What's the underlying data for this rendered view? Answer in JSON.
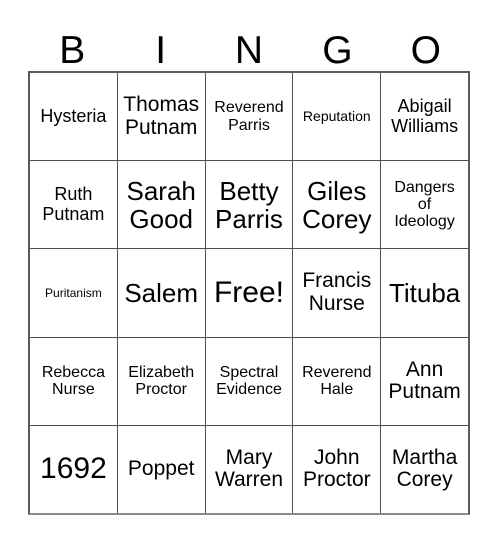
{
  "header": {
    "letters": [
      "B",
      "I",
      "N",
      "G",
      "O"
    ]
  },
  "grid": {
    "rows": [
      [
        {
          "text": "Hysteria",
          "size": "fs-lg"
        },
        {
          "text": "Thomas\nPutnam",
          "size": "fs-xl"
        },
        {
          "text": "Reverend\nParris",
          "size": "fs-md"
        },
        {
          "text": "Reputation",
          "size": "fs-sm"
        },
        {
          "text": "Abigail\nWilliams",
          "size": "fs-lg"
        }
      ],
      [
        {
          "text": "Ruth\nPutnam",
          "size": "fs-lg"
        },
        {
          "text": "Sarah\nGood",
          "size": "fs-xxl"
        },
        {
          "text": "Betty\nParris",
          "size": "fs-xxl"
        },
        {
          "text": "Giles\nCorey",
          "size": "fs-xxl"
        },
        {
          "text": "Dangers\nof\nIdeology",
          "size": "fs-md"
        }
      ],
      [
        {
          "text": "Puritanism",
          "size": "fs-xs"
        },
        {
          "text": "Salem",
          "size": "fs-xxl"
        },
        {
          "text": "Free!",
          "size": "fs-huge"
        },
        {
          "text": "Francis\nNurse",
          "size": "fs-xl"
        },
        {
          "text": "Tituba",
          "size": "fs-xxl"
        }
      ],
      [
        {
          "text": "Rebecca\nNurse",
          "size": "fs-md"
        },
        {
          "text": "Elizabeth\nProctor",
          "size": "fs-md"
        },
        {
          "text": "Spectral\nEvidence",
          "size": "fs-md"
        },
        {
          "text": "Reverend\nHale",
          "size": "fs-md"
        },
        {
          "text": "Ann\nPutnam",
          "size": "fs-xl"
        }
      ],
      [
        {
          "text": "1692",
          "size": "fs-huge"
        },
        {
          "text": "Poppet",
          "size": "fs-xl"
        },
        {
          "text": "Mary\nWarren",
          "size": "fs-xl"
        },
        {
          "text": "John\nProctor",
          "size": "fs-xl"
        },
        {
          "text": "Martha\nCorey",
          "size": "fs-xl"
        }
      ]
    ]
  },
  "colors": {
    "background": "#ffffff",
    "text": "#000000",
    "grid_line": "#4d4d4d",
    "grid_border": "#5a5a5a"
  }
}
